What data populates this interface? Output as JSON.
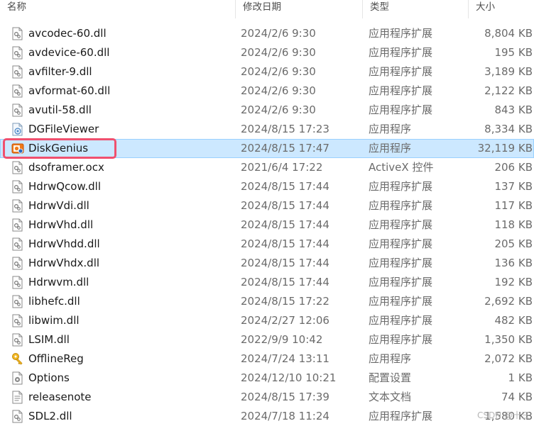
{
  "columns": {
    "name": "名称",
    "date": "修改日期",
    "type": "类型",
    "size": "大小"
  },
  "files": [
    {
      "name": "avcodec-60.dll",
      "date": "2024/2/6 9:30",
      "type": "应用程序扩展",
      "size": "8,804 KB",
      "icon": "dll-file-icon"
    },
    {
      "name": "avdevice-60.dll",
      "date": "2024/2/6 9:30",
      "type": "应用程序扩展",
      "size": "195 KB",
      "icon": "dll-file-icon"
    },
    {
      "name": "avfilter-9.dll",
      "date": "2024/2/6 9:30",
      "type": "应用程序扩展",
      "size": "3,189 KB",
      "icon": "dll-file-icon"
    },
    {
      "name": "avformat-60.dll",
      "date": "2024/2/6 9:30",
      "type": "应用程序扩展",
      "size": "2,122 KB",
      "icon": "dll-file-icon"
    },
    {
      "name": "avutil-58.dll",
      "date": "2024/2/6 9:30",
      "type": "应用程序扩展",
      "size": "843 KB",
      "icon": "dll-file-icon"
    },
    {
      "name": "DGFileViewer",
      "date": "2024/8/15 17:23",
      "type": "应用程序",
      "size": "8,334 KB",
      "icon": "file-viewer-icon"
    },
    {
      "name": "DiskGenius",
      "date": "2024/8/15 17:47",
      "type": "应用程序",
      "size": "32,119 KB",
      "icon": "diskgenius-app-icon",
      "selected": true
    },
    {
      "name": "dsoframer.ocx",
      "date": "2021/6/4 17:22",
      "type": "ActiveX 控件",
      "size": "206 KB",
      "icon": "ocx-file-icon"
    },
    {
      "name": "HdrwQcow.dll",
      "date": "2024/8/15 17:44",
      "type": "应用程序扩展",
      "size": "137 KB",
      "icon": "dll-file-icon"
    },
    {
      "name": "HdrwVdi.dll",
      "date": "2024/8/15 17:44",
      "type": "应用程序扩展",
      "size": "117 KB",
      "icon": "dll-file-icon"
    },
    {
      "name": "HdrwVhd.dll",
      "date": "2024/8/15 17:44",
      "type": "应用程序扩展",
      "size": "118 KB",
      "icon": "dll-file-icon"
    },
    {
      "name": "HdrwVhdd.dll",
      "date": "2024/8/15 17:44",
      "type": "应用程序扩展",
      "size": "205 KB",
      "icon": "dll-file-icon"
    },
    {
      "name": "HdrwVhdx.dll",
      "date": "2024/8/15 17:44",
      "type": "应用程序扩展",
      "size": "136 KB",
      "icon": "dll-file-icon"
    },
    {
      "name": "Hdrwvm.dll",
      "date": "2024/8/15 17:44",
      "type": "应用程序扩展",
      "size": "192 KB",
      "icon": "dll-file-icon"
    },
    {
      "name": "libhefc.dll",
      "date": "2024/8/15 17:22",
      "type": "应用程序扩展",
      "size": "2,692 KB",
      "icon": "dll-file-icon"
    },
    {
      "name": "libwim.dll",
      "date": "2024/2/27 12:06",
      "type": "应用程序扩展",
      "size": "482 KB",
      "icon": "dll-file-icon"
    },
    {
      "name": "LSIM.dll",
      "date": "2022/9/9 10:42",
      "type": "应用程序扩展",
      "size": "1,350 KB",
      "icon": "dll-file-icon"
    },
    {
      "name": "OfflineReg",
      "date": "2024/7/24 13:11",
      "type": "应用程序",
      "size": "2,072 KB",
      "icon": "key-app-icon"
    },
    {
      "name": "Options",
      "date": "2024/12/10 10:21",
      "type": "配置设置",
      "size": "1 KB",
      "icon": "config-file-icon"
    },
    {
      "name": "releasenote",
      "date": "2024/8/15 17:39",
      "type": "文本文档",
      "size": "74 KB",
      "icon": "text-file-icon"
    },
    {
      "name": "SDL2.dll",
      "date": "2024/7/18 11:24",
      "type": "应用程序扩展",
      "size": "1,580 KB",
      "icon": "dll-file-icon"
    }
  ],
  "watermark": "CSDN @十三",
  "colors": {
    "selection": "#cce8ff",
    "highlight_border": "#f0506e"
  }
}
